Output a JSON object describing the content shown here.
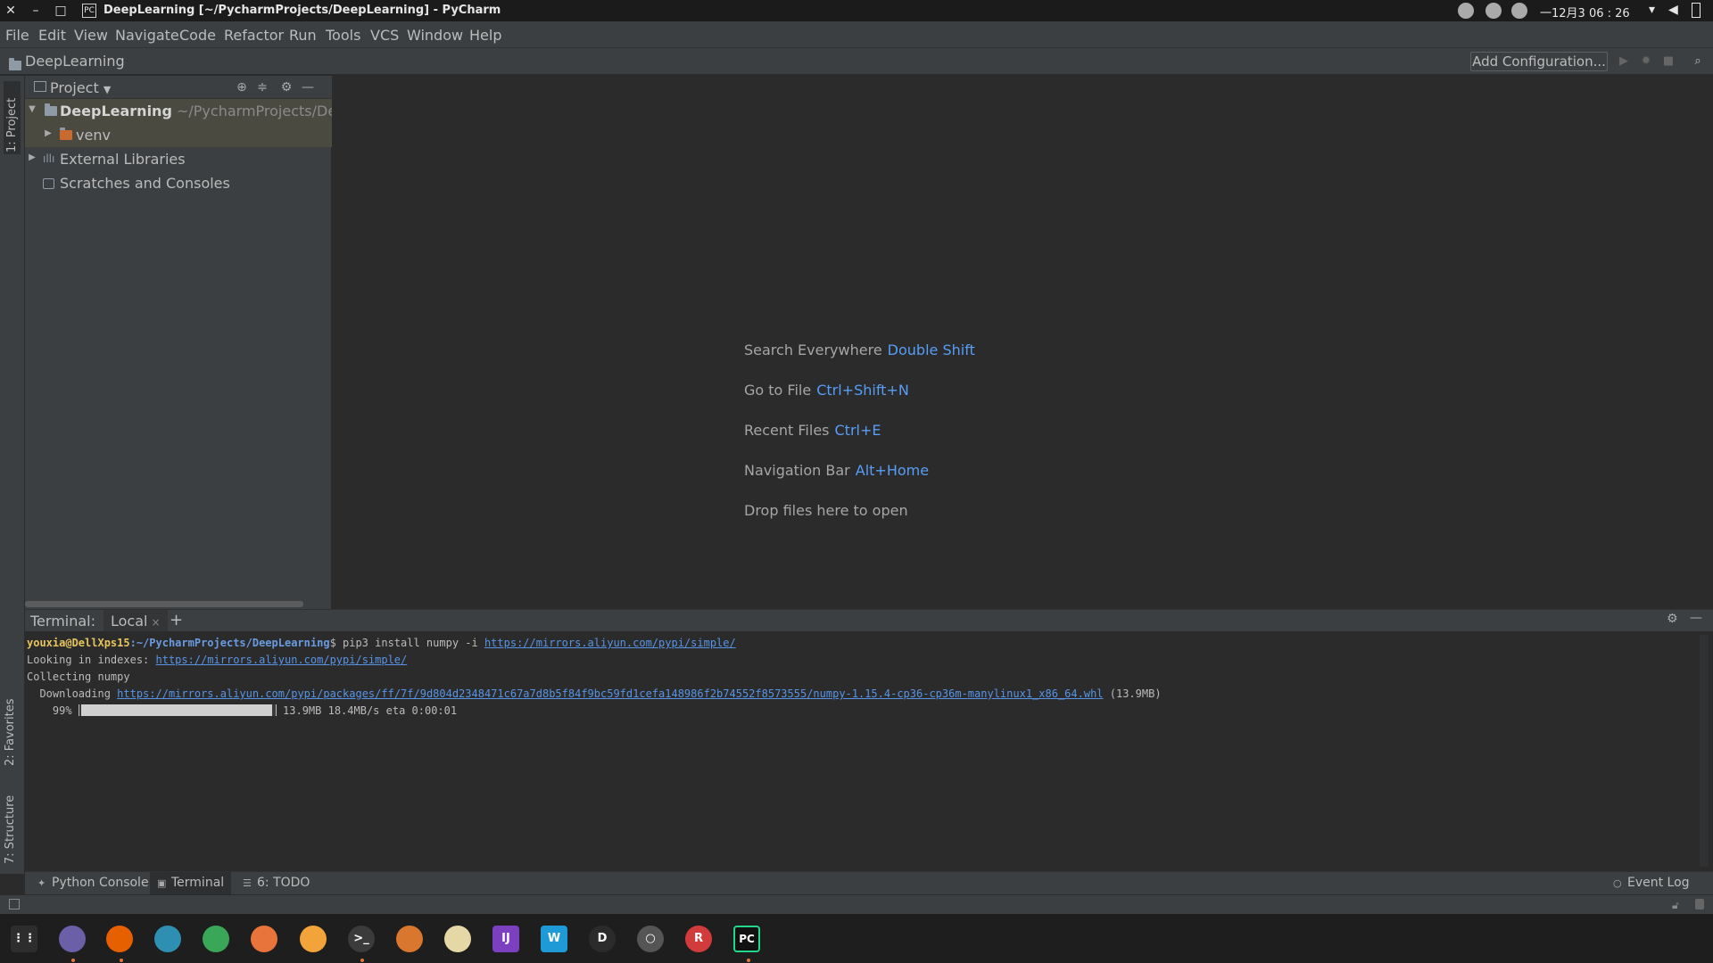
{
  "window": {
    "title": "DeepLearning [~/PycharmProjects/DeepLearning] - PyCharm",
    "app_icon_label": "PC",
    "close_glyph": "✕",
    "minimize_glyph": "–",
    "maximize_glyph": "□"
  },
  "system": {
    "clock": "一12月3 06 : 26"
  },
  "menu": [
    "File",
    "Edit",
    "View",
    "Navigate",
    "Code",
    "Refactor",
    "Run",
    "Tools",
    "VCS",
    "Window",
    "Help"
  ],
  "navbar": {
    "crumb": "DeepLearning",
    "add_config": "Add Configuration..."
  },
  "left_stripe": {
    "project_tab": "1: Project",
    "favorites_tab": "2: Favorites",
    "structure_tab": "7: Structure"
  },
  "project_panel": {
    "title": "Project",
    "tree": [
      {
        "label": "DeepLearning",
        "hint": "~/PycharmProjects/DeepLear",
        "expanded": true
      },
      {
        "label": "venv",
        "expanded": false
      },
      {
        "label": "External Libraries",
        "expanded": false
      },
      {
        "label": "Scratches and Consoles"
      }
    ]
  },
  "editor_tips": [
    {
      "text": "Search Everywhere",
      "key": "Double Shift"
    },
    {
      "text": "Go to File",
      "key": "Ctrl+Shift+N"
    },
    {
      "text": "Recent Files",
      "key": "Ctrl+E"
    },
    {
      "text": "Navigation Bar",
      "key": "Alt+Home"
    },
    {
      "text": "Drop files here to open",
      "key": ""
    }
  ],
  "terminal": {
    "label": "Terminal:",
    "tab": "Local",
    "tab_close": "×",
    "add": "+",
    "user": "youxia@DellXps15",
    "path": ":~/PycharmProjects/DeepLearning",
    "command": "$ pip3 install numpy -i ",
    "command_url": "https://mirrors.aliyun.com/pypi/simple/",
    "line2_prefix": "Looking in indexes: ",
    "line2_url": "https://mirrors.aliyun.com/pypi/simple/",
    "line3": "Collecting numpy",
    "line4_prefix": "  Downloading ",
    "line4_url": "https://mirrors.aliyun.com/pypi/packages/ff/7f/9d804d2348471c67a7d8b5f84f9bc59fd1cefa148986f2b74552f8573555/numpy-1.15.4-cp36-cp36m-manylinux1_x86_64.whl",
    "line4_size": " (13.9MB)",
    "progress_percent": "    99% ",
    "progress_fraction": 0.99,
    "progress_stats": " 13.9MB 18.4MB/s eta 0:00:01"
  },
  "bottom_tools": {
    "python_console": "Python Console",
    "terminal": "Terminal",
    "todo": "6: TODO",
    "event_log": "Event Log"
  },
  "dock": [
    {
      "name": "launcher",
      "color": "#2d2d2d",
      "label": "⋮⋮"
    },
    {
      "name": "files",
      "color": "#6b5fa8",
      "label": ""
    },
    {
      "name": "firefox",
      "color": "#e66000",
      "label": ""
    },
    {
      "name": "docs",
      "color": "#2f8fb3",
      "label": ""
    },
    {
      "name": "sheets",
      "color": "#3aa657",
      "label": ""
    },
    {
      "name": "slides",
      "color": "#e8743b",
      "label": ""
    },
    {
      "name": "music",
      "color": "#f2a33a",
      "label": ""
    },
    {
      "name": "terminal",
      "color": "#3b3b3b",
      "label": ">_"
    },
    {
      "name": "app-orange",
      "color": "#d9772e",
      "label": ""
    },
    {
      "name": "app-ring",
      "color": "#e6d8a6",
      "label": ""
    },
    {
      "name": "intellij",
      "color": "#7b3fbf",
      "label": "IJ"
    },
    {
      "name": "webstorm",
      "color": "#1e9bd7",
      "label": "W"
    },
    {
      "name": "app-d",
      "color": "#2b2b2b",
      "label": "D"
    },
    {
      "name": "chrome",
      "color": "#555555",
      "label": "○"
    },
    {
      "name": "app-r",
      "color": "#d23b3b",
      "label": "R"
    },
    {
      "name": "pycharm",
      "color": "#111111",
      "label": "PC"
    }
  ]
}
